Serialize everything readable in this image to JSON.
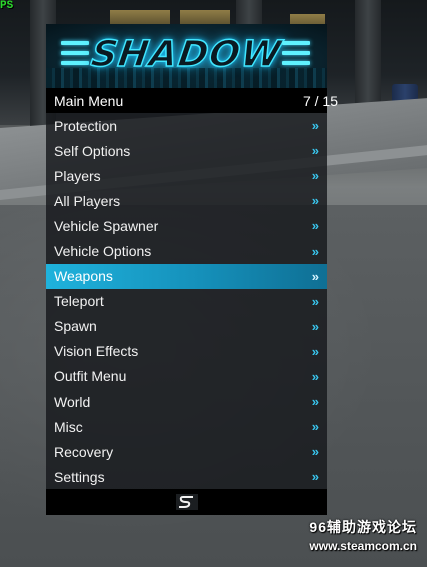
{
  "overlay": {
    "fps_label": "PS"
  },
  "menu": {
    "banner": {
      "logo_text": "SHADOW"
    },
    "header": {
      "title": "Main Menu",
      "page_counter": "7 / 15"
    },
    "items": [
      {
        "label": "Protection",
        "selected": false
      },
      {
        "label": "Self Options",
        "selected": false
      },
      {
        "label": "Players",
        "selected": false
      },
      {
        "label": "All Players",
        "selected": false
      },
      {
        "label": "Vehicle Spawner",
        "selected": false
      },
      {
        "label": "Vehicle Options",
        "selected": false
      },
      {
        "label": "Weapons",
        "selected": true
      },
      {
        "label": "Teleport",
        "selected": false
      },
      {
        "label": "Spawn",
        "selected": false
      },
      {
        "label": "Vision Effects",
        "selected": false
      },
      {
        "label": "Outfit Menu",
        "selected": false
      },
      {
        "label": "World",
        "selected": false
      },
      {
        "label": "Misc",
        "selected": false
      },
      {
        "label": "Recovery",
        "selected": false
      },
      {
        "label": "Settings",
        "selected": false
      }
    ],
    "submenu_arrow": "»",
    "colors": {
      "accent": "#1fb2dc",
      "arrow": "#39c6ee",
      "header_bg": "#000000"
    }
  },
  "watermark": {
    "site_name": "96辅助游戏论坛",
    "url": "www.steamcom.cn"
  }
}
